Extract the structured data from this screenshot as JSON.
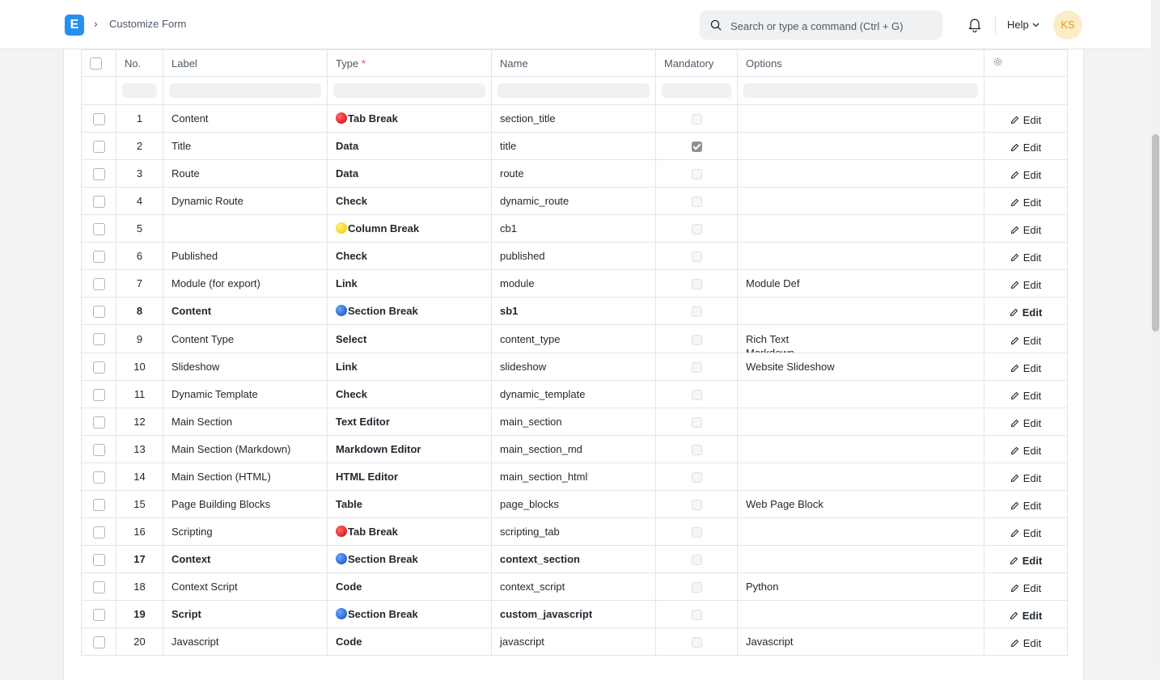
{
  "navbar": {
    "logo_letter": "E",
    "breadcrumb_sep": "›",
    "breadcrumb": "Customize Form",
    "search_placeholder": "Search or type a command (Ctrl + G)",
    "help_label": "Help",
    "avatar_initials": "KS"
  },
  "table": {
    "headers": {
      "no": "No.",
      "label": "Label",
      "type": "Type",
      "type_required_mark": "*",
      "name": "Name",
      "mandatory": "Mandatory",
      "options": "Options"
    },
    "edit_label": "Edit",
    "rows": [
      {
        "no": "1",
        "label": "Content",
        "type": "Tab Break",
        "marker": "red",
        "name": "section_title",
        "mandatory": false,
        "options": "",
        "bold": false
      },
      {
        "no": "2",
        "label": "Title",
        "type": "Data",
        "marker": "",
        "name": "title",
        "mandatory": true,
        "options": "",
        "bold": false
      },
      {
        "no": "3",
        "label": "Route",
        "type": "Data",
        "marker": "",
        "name": "route",
        "mandatory": false,
        "options": "",
        "bold": false
      },
      {
        "no": "4",
        "label": "Dynamic Route",
        "type": "Check",
        "marker": "",
        "name": "dynamic_route",
        "mandatory": false,
        "options": "",
        "bold": false
      },
      {
        "no": "5",
        "label": "",
        "type": "Column Break",
        "marker": "yellow",
        "name": "cb1",
        "mandatory": false,
        "options": "",
        "bold": false
      },
      {
        "no": "6",
        "label": "Published",
        "type": "Check",
        "marker": "",
        "name": "published",
        "mandatory": false,
        "options": "",
        "bold": false
      },
      {
        "no": "7",
        "label": "Module (for export)",
        "type": "Link",
        "marker": "",
        "name": "module",
        "mandatory": false,
        "options": "Module Def",
        "bold": false
      },
      {
        "no": "8",
        "label": "Content",
        "type": "Section Break",
        "marker": "blue",
        "name": "sb1",
        "mandatory": false,
        "options": "",
        "bold": true
      },
      {
        "no": "9",
        "label": "Content Type",
        "type": "Select",
        "marker": "",
        "name": "content_type",
        "mandatory": false,
        "options": "Rich Text\nMarkdown",
        "bold": false
      },
      {
        "no": "10",
        "label": "Slideshow",
        "type": "Link",
        "marker": "",
        "name": "slideshow",
        "mandatory": false,
        "options": "Website Slideshow",
        "bold": false
      },
      {
        "no": "11",
        "label": "Dynamic Template",
        "type": "Check",
        "marker": "",
        "name": "dynamic_template",
        "mandatory": false,
        "options": "",
        "bold": false
      },
      {
        "no": "12",
        "label": "Main Section",
        "type": "Text Editor",
        "marker": "",
        "name": "main_section",
        "mandatory": false,
        "options": "",
        "bold": false
      },
      {
        "no": "13",
        "label": "Main Section (Markdown)",
        "type": "Markdown Editor",
        "marker": "",
        "name": "main_section_md",
        "mandatory": false,
        "options": "",
        "bold": false
      },
      {
        "no": "14",
        "label": "Main Section (HTML)",
        "type": "HTML Editor",
        "marker": "",
        "name": "main_section_html",
        "mandatory": false,
        "options": "",
        "bold": false
      },
      {
        "no": "15",
        "label": "Page Building Blocks",
        "type": "Table",
        "marker": "",
        "name": "page_blocks",
        "mandatory": false,
        "options": "Web Page Block",
        "bold": false
      },
      {
        "no": "16",
        "label": "Scripting",
        "type": "Tab Break",
        "marker": "red",
        "name": "scripting_tab",
        "mandatory": false,
        "options": "",
        "bold": false
      },
      {
        "no": "17",
        "label": "Context",
        "type": "Section Break",
        "marker": "blue",
        "name": "context_section",
        "mandatory": false,
        "options": "",
        "bold": true
      },
      {
        "no": "18",
        "label": "Context Script",
        "type": "Code",
        "marker": "",
        "name": "context_script",
        "mandatory": false,
        "options": "Python",
        "bold": false
      },
      {
        "no": "19",
        "label": "Script",
        "type": "Section Break",
        "marker": "blue",
        "name": "custom_javascript",
        "mandatory": false,
        "options": "",
        "bold": true
      },
      {
        "no": "20",
        "label": "Javascript",
        "type": "Code",
        "marker": "",
        "name": "javascript",
        "mandatory": false,
        "options": "Javascript",
        "bold": false
      }
    ]
  }
}
